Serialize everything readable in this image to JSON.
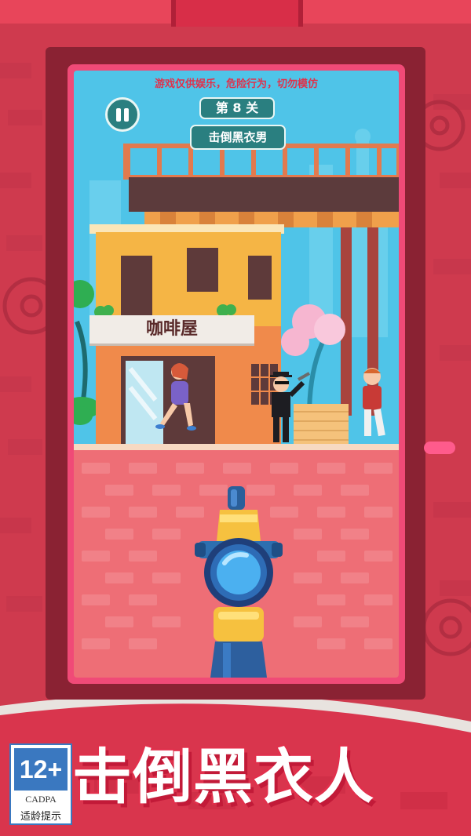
{
  "hud": {
    "warning": "游戏仅供娱乐，危险行为，切勿模仿",
    "level_label": "第 8 关",
    "mission": "击倒黑衣男",
    "pause_icon": "pause-icon"
  },
  "scene": {
    "cafe_sign": "咖啡屋",
    "characters": [
      "woman-icon",
      "agent-in-black-icon",
      "man-in-red-icon"
    ],
    "weapon": "sniper-rifle-icon"
  },
  "banner": {
    "title": "击倒黑衣人"
  },
  "age_rating": {
    "age": "12+",
    "org": "CADPA",
    "note": "适龄提示"
  },
  "colors": {
    "background": "#cf3a4e",
    "frame": "#8a2233",
    "screen_border": "#f04a77",
    "sky": "#4fc4e8",
    "cafe_wall": "#f5b545",
    "brick_floor": "#ee6e76",
    "hud_pill": "#2a7f80",
    "warning_text": "#e0314b",
    "rating_blue": "#3a78c0"
  }
}
